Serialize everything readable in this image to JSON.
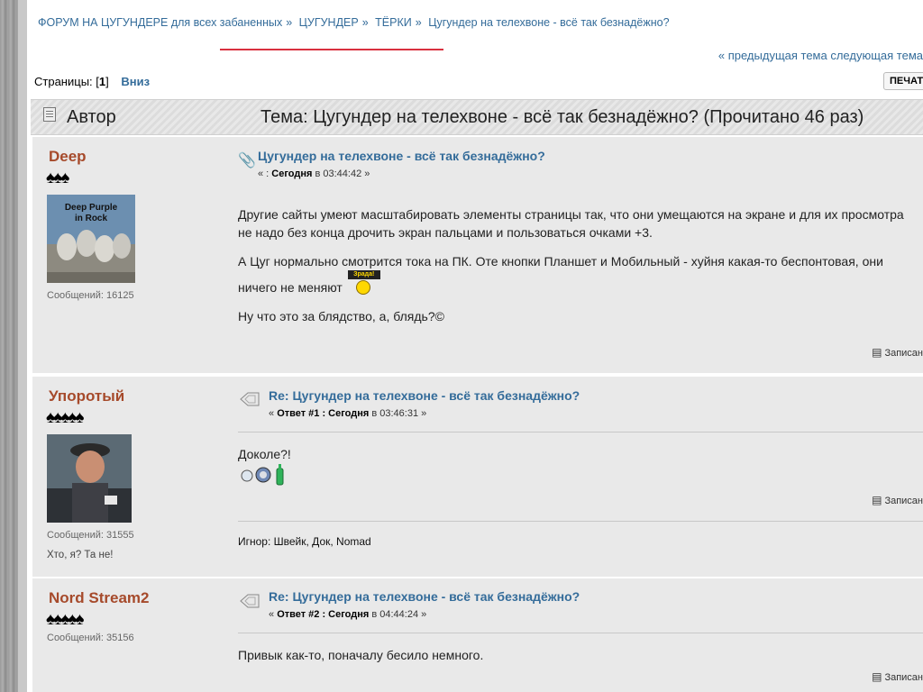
{
  "breadcrumb": {
    "items": [
      "ФОРУМ НА ЦУГУНДЕРЕ для всех забаненных",
      "ЦУГУНДЕР",
      "ТЁРКИ",
      "Цугундер на телехвоне - всё так безнадёжно?"
    ],
    "separator": "»"
  },
  "nav": {
    "prevnext": "« предыдущая тема следующая тема",
    "pages_label": "Страницы: [",
    "current_page": "1",
    "pages_close": "]",
    "down": "Вниз",
    "print": "ПЕЧАТЬ"
  },
  "header": {
    "author": "Автор",
    "topic": "Тема: Цугундер на телехвоне - всё так безнадёжно?  (Прочитано 46 раз)"
  },
  "posts": [
    {
      "author": "Deep",
      "stars": "♠♠♠",
      "avatar_caption": "Deep Purple in Rock",
      "messages": "Сообщений: 16125",
      "subject": "Цугундер на телехвоне - всё так безнадёжно?",
      "meta_prefix": "« : ",
      "meta_day": "Сегодня",
      "meta_time": " в 03:44:42 »",
      "paragraphs": [
        "Другие сайты умеют масштабировать элементы страницы так, что они умещаются на экране и для их просмотра не надо без конца дрочить экран пальцами и пользоваться очками +3.",
        "А Цуг нормально смотрится тока на ПК. Оте кнопки Планшет и Мобильный - хуйня какая-то беспонтовая, они ничего не меняют",
        "Ну что это за блядство, а, блядь?©"
      ],
      "smiley_text": "Зрада!",
      "record": "Записан"
    },
    {
      "author": "Упоротый",
      "stars": "♠♠♠♠♠",
      "messages": "Сообщений: 31555",
      "custom_title": "Хто, я? Та не!",
      "subject": "Re: Цугундер на телехвоне - всё так безнадёжно?",
      "meta_prefix": "« ",
      "meta_bold": "Ответ #1 : Сегодня",
      "meta_time": " в 03:46:31 »",
      "text": "Доколе?!",
      "record": "Записан",
      "signature": "Игнор: Швейк, Док, Nomad"
    },
    {
      "author": "Nord Stream2",
      "stars": "♠♠♠♠♠",
      "messages": "Сообщений: 35156",
      "subject": "Re: Цугундер на телехвоне - всё так безнадёжно?",
      "meta_prefix": "« ",
      "meta_bold": "Ответ #2 : Сегодня",
      "meta_time": " в 04:44:24 »",
      "text": "Привык как-то, поначалу бесило немного.",
      "record": "Записан"
    }
  ],
  "icons": {
    "attachment": "paperclip-icon",
    "topic": "topic-icon",
    "record": "record-icon"
  }
}
